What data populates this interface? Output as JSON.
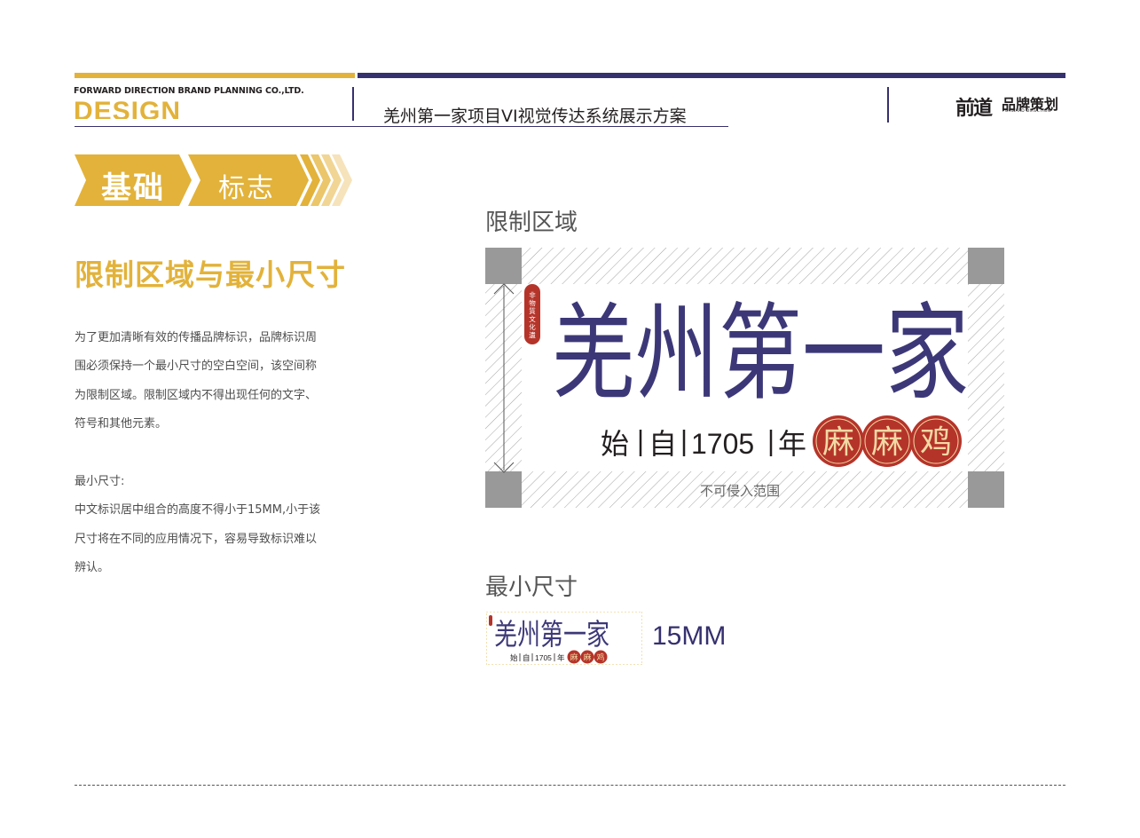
{
  "header": {
    "company": "FORWARD DIRECTION BRAND PLANNING CO.,LTD.",
    "design_word": "DESIGN",
    "project_title": "羌州第一家项目VI视觉传达系统展示方案",
    "brand_logo_mark": "前道",
    "brand_logo_cn": "品牌策划",
    "brand_logo_en": "FORWARD DIRECTION"
  },
  "banner": {
    "category": "基础",
    "subcategory": "标志"
  },
  "content": {
    "heading": "限制区域与最小尺寸",
    "paragraph_lines": [
      "为了更加清晰有效的传播品牌标识，品牌标识周",
      "围必须保持一个最小尺寸的空白空间，该空间称",
      "为限制区域。限制区域内不得出现任何的文字、",
      "符号和其他元素。"
    ],
    "min_size_title": "最小尺寸:",
    "min_size_lines": [
      "中文标识居中组合的高度不得小于15MM,小于该",
      "尺寸将在不同的应用情况下，容易导致标识难以",
      "辨认。"
    ]
  },
  "figures": {
    "clear_zone_label": "限制区域",
    "forbidden_label": "不可侵入范围",
    "min_size_label": "最小尺寸",
    "min_size_value": "15MM"
  },
  "logo": {
    "name": "羌州第一家",
    "seal_text": "非物質文化遺產",
    "tagline_chars": [
      "始",
      "自",
      "1705",
      "年"
    ],
    "product_chars": [
      "麻",
      "麻",
      "鸡"
    ]
  },
  "colors": {
    "gold": "#e2b23a",
    "navy": "#35306e",
    "logo_purple": "#3c3878",
    "seal_red": "#b5342a",
    "corner_gray": "#999999"
  }
}
